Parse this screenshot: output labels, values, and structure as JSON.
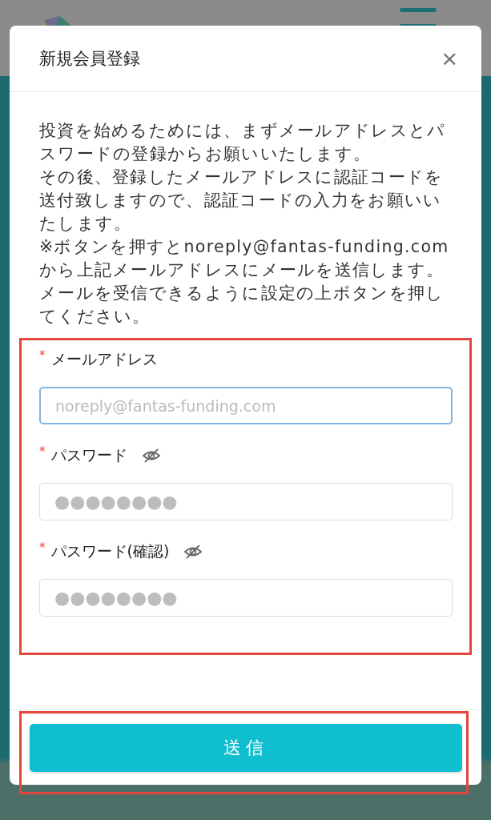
{
  "dialog": {
    "title": "新規会員登録",
    "close_label": "×",
    "intro": [
      "投資を始めるためには、まずメールアドレスとパスワードの登録からお願いいたします。",
      "その後、登録したメールアドレスに認証コードを送付致しますので、認証コードの入力をお願いいたします。",
      "※ボタンを押すとnoreply@fantas-funding.comから上記メールアドレスにメールを送信します。メールを受信できるように設定の上ボタンを押してください。"
    ],
    "form_highlighted": true,
    "fields": [
      {
        "kind": "email",
        "label": "メールアドレス",
        "required_mark": "*",
        "placeholder": "noreply@fantas-funding.com",
        "focused": true
      },
      {
        "kind": "password",
        "label": "パスワード",
        "required_mark": "*",
        "value": "●●●●●●●●",
        "visible": false,
        "focused": false
      },
      {
        "kind": "password",
        "label": "パスワード(確認)",
        "required_mark": "*",
        "value": "●●●●●●●●",
        "visible": false,
        "focused": false
      }
    ],
    "submit_label": "送信",
    "submit_highlighted": true
  }
}
